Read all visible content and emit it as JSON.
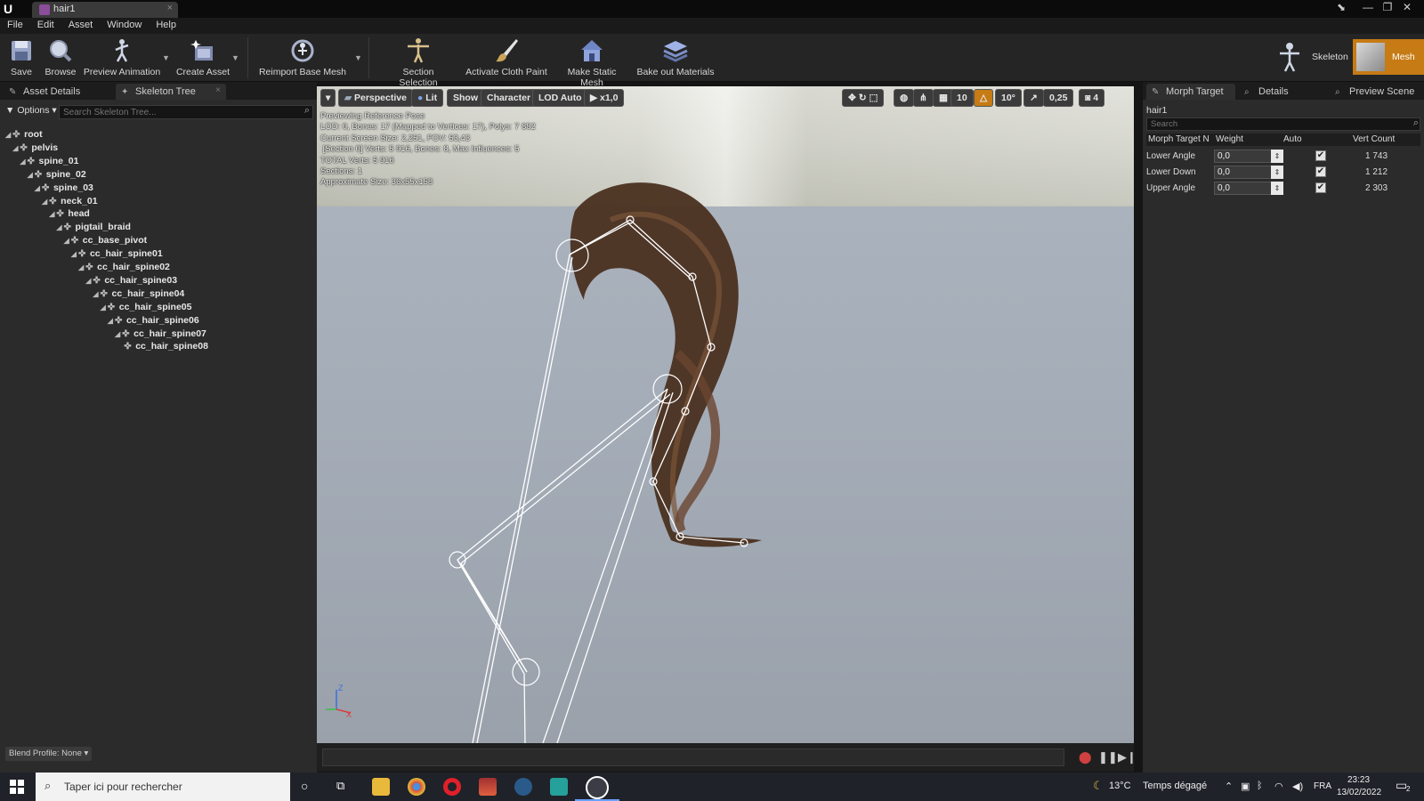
{
  "window": {
    "tab_title": "hair1",
    "minimize_glyph": "—",
    "maximize_glyph": "❐",
    "close_glyph": "✕",
    "pin_glyph": "⬊"
  },
  "menu": [
    "File",
    "Edit",
    "Asset",
    "Window",
    "Help"
  ],
  "toolbar": {
    "save": "Save",
    "browse": "Browse",
    "preview_animation": "Preview Animation",
    "create_asset": "Create Asset",
    "reimport_base_mesh": "Reimport Base Mesh",
    "section_selection": "Section Selection",
    "activate_cloth_paint": "Activate Cloth Paint",
    "make_static_mesh": "Make Static Mesh",
    "bake_out_materials": "Bake out Materials",
    "skeleton": "Skeleton",
    "mesh": "Mesh"
  },
  "left_panel": {
    "tabs": [
      "Asset Details",
      "Skeleton Tree"
    ],
    "options_label": "Options",
    "search_placeholder": "Search Skeleton Tree...",
    "blend_profile": "Blend Profile: None",
    "bones": [
      {
        "name": "root",
        "depth": 0
      },
      {
        "name": "pelvis",
        "depth": 1
      },
      {
        "name": "spine_01",
        "depth": 2
      },
      {
        "name": "spine_02",
        "depth": 3
      },
      {
        "name": "spine_03",
        "depth": 4
      },
      {
        "name": "neck_01",
        "depth": 5
      },
      {
        "name": "head",
        "depth": 6
      },
      {
        "name": "pigtail_braid",
        "depth": 7
      },
      {
        "name": "cc_base_pivot",
        "depth": 8
      },
      {
        "name": "cc_hair_spine01",
        "depth": 9
      },
      {
        "name": "cc_hair_spine02",
        "depth": 10
      },
      {
        "name": "cc_hair_spine03",
        "depth": 11
      },
      {
        "name": "cc_hair_spine04",
        "depth": 12
      },
      {
        "name": "cc_hair_spine05",
        "depth": 13
      },
      {
        "name": "cc_hair_spine06",
        "depth": 14
      },
      {
        "name": "cc_hair_spine07",
        "depth": 15
      },
      {
        "name": "cc_hair_spine08",
        "depth": 16
      }
    ]
  },
  "viewport": {
    "perspective": "Perspective",
    "lit": "Lit",
    "show": "Show",
    "character": "Character",
    "lod": "LOD Auto",
    "play_rate": "x1,0",
    "grid_snap": "10",
    "rot_snap": "10°",
    "scale_snap": "0,25",
    "cam_speed": "4",
    "info_lines": [
      "Previewing Reference Pose",
      "LOD: 0, Bones: 17 (Mapped to Vertices: 17), Polys: 7 882",
      "Current Screen Size: 2,251, FOV: 53,43",
      " [Section 0] Verts: 5 916, Bones: 8, Max Influences: 5",
      "TOTAL Verts: 5 916",
      "Sections: 1",
      "Approximate Size: 36x55x158"
    ],
    "axis_z": "Z",
    "axis_x": "X"
  },
  "right_panel": {
    "tabs": [
      "Morph Target",
      "Details",
      "Preview Scene"
    ],
    "asset_name": "hair1",
    "search_placeholder": "Search",
    "headers": {
      "name": "Morph Target N",
      "weight": "Weight",
      "auto": "Auto",
      "count": "Vert Count"
    },
    "morphs": [
      {
        "name": "Lower Angle",
        "weight": "0,0",
        "auto": true,
        "count": "1 743"
      },
      {
        "name": "Lower Down",
        "weight": "0,0",
        "auto": true,
        "count": "1 212"
      },
      {
        "name": "Upper Angle",
        "weight": "0,0",
        "auto": true,
        "count": "2 303"
      }
    ]
  },
  "taskbar": {
    "search_placeholder": "Taper ici pour rechercher",
    "weather_temp": "13°C",
    "weather_desc": "Temps dégagé",
    "lang": "FRA",
    "time": "23:23",
    "date": "13/02/2022",
    "notif_count": "2"
  },
  "colors": {
    "accent_orange": "#c67b14",
    "panel_bg": "#2b2b2b",
    "toolbar_bg": "#252525"
  }
}
